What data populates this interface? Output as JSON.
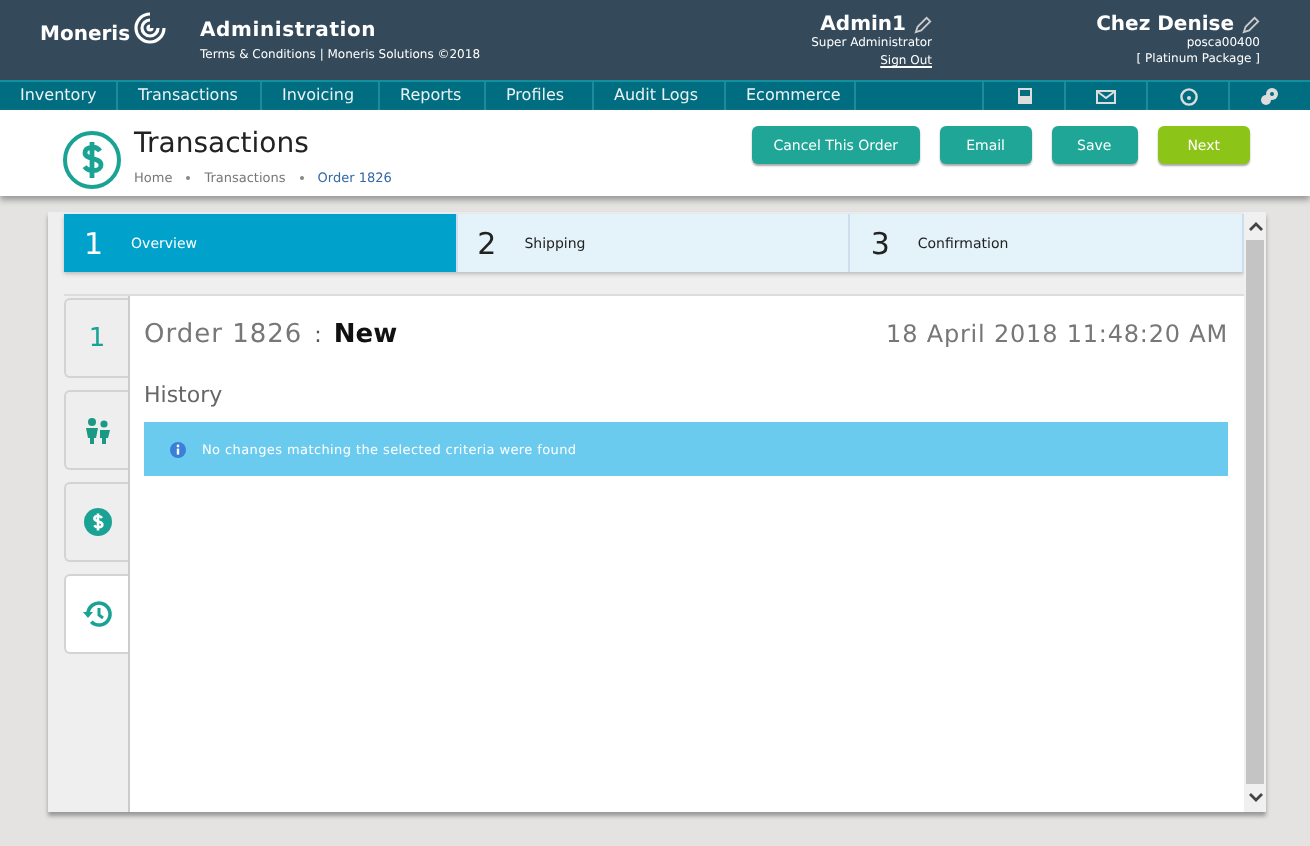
{
  "header": {
    "logo": "Moneris",
    "title": "Administration",
    "subtitle": "Terms & Conditions | Moneris Solutions ©2018",
    "user": {
      "name": "Admin1",
      "role": "Super Administrator",
      "sign_out": "Sign Out"
    },
    "merchant": {
      "name": "Chez Denise",
      "id": "posca00400",
      "package": "[ Platinum Package ]"
    }
  },
  "nav": [
    "Inventory",
    "Transactions",
    "Invoicing",
    "Reports",
    "Profiles",
    "Audit Logs",
    "Ecommerce"
  ],
  "page": {
    "title": "Transactions",
    "breadcrumbs": [
      {
        "label": "Home",
        "current": false
      },
      {
        "label": "Transactions",
        "current": false
      },
      {
        "label": "Order 1826",
        "current": true
      }
    ],
    "buttons": [
      {
        "label": "Cancel This Order",
        "kind": "secondary"
      },
      {
        "label": "Email",
        "kind": "secondary"
      },
      {
        "label": "Save",
        "kind": "secondary"
      },
      {
        "label": "Next",
        "kind": "primary"
      }
    ]
  },
  "steps": [
    {
      "number": "1",
      "label": "Overview",
      "selected": true
    },
    {
      "number": "2",
      "label": "Shipping",
      "selected": false
    },
    {
      "number": "3",
      "label": "Confirmation",
      "selected": false
    }
  ],
  "side_tabs": [
    {
      "kind": "number",
      "label": "1",
      "selected": false
    },
    {
      "kind": "people",
      "selected": false
    },
    {
      "kind": "dollar",
      "selected": false
    },
    {
      "kind": "history",
      "selected": true
    }
  ],
  "order": {
    "title": "Order 1826",
    "separator": ":",
    "status": "New",
    "date": "18 April 2018 11:48:20 AM",
    "section": "History",
    "alert": "No changes matching the selected criteria were found"
  }
}
